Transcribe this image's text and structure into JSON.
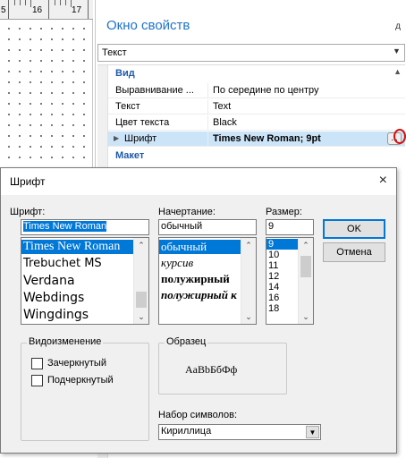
{
  "designer": {
    "ruler_numbers": [
      "5",
      "16",
      "17"
    ]
  },
  "properties": {
    "title": "Окно свойств",
    "pin_glyph": "д",
    "object_combo": "Текст",
    "categories": {
      "view": "Вид",
      "layout": "Макет"
    },
    "rows": [
      {
        "name": "Выравнивание ...",
        "value": "По середине по центру"
      },
      {
        "name": "Текст",
        "value": "Text"
      },
      {
        "name": "Цвет текста",
        "value": "Black"
      },
      {
        "name": "Шрифт",
        "value": "Times New Roman; 9pt"
      }
    ],
    "ellipsis": "..."
  },
  "font_dialog": {
    "title": "Шрифт",
    "close": "×",
    "font_label": "Шрифт:",
    "font_value": "Times New Roman",
    "fonts": [
      "Times New Roman",
      "Trebuchet MS",
      "Verdana",
      "Webdings",
      "Wingdings"
    ],
    "style_label": "Начертание:",
    "style_value": "обычный",
    "styles": [
      "обычный",
      "курсив",
      "полужирный",
      "полужирный к"
    ],
    "size_label": "Размер:",
    "size_value": "9",
    "sizes": [
      "9",
      "10",
      "11",
      "12",
      "14",
      "16",
      "18"
    ],
    "ok": "OK",
    "cancel": "Отмена",
    "effects_title": "Видоизменение",
    "strikeout": "Зачеркнутый",
    "underline": "Подчеркнутый",
    "sample_title": "Образец",
    "sample_text": "AaBbБбФф",
    "charset_label": "Набор символов:",
    "charset_value": "Кириллица"
  },
  "colors": {
    "accent": "#0078d7",
    "title_blue": "#1e73c8",
    "selected_row": "#cce4f7",
    "highlight_circle": "#d01010"
  }
}
